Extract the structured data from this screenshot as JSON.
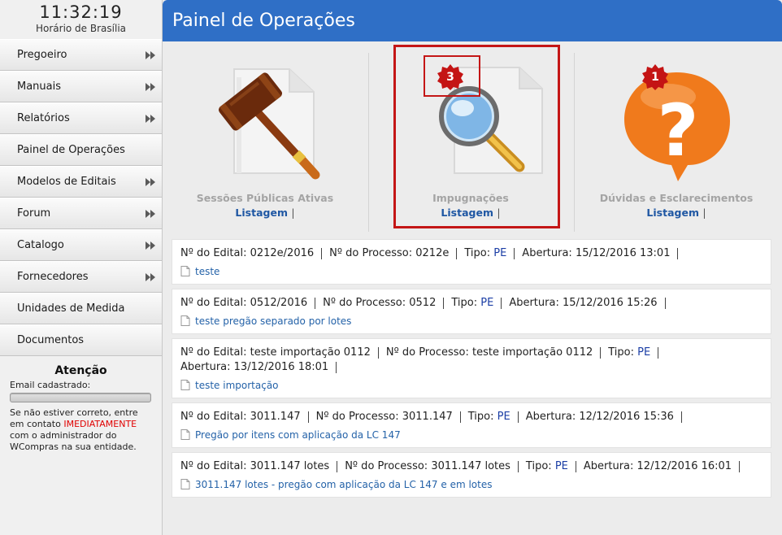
{
  "sidebar": {
    "clock": {
      "time": "11:32:19",
      "timezone": "Horário de Brasília"
    },
    "items": [
      {
        "label": "Pregoeiro",
        "has_submenu": true
      },
      {
        "label": "Manuais",
        "has_submenu": true
      },
      {
        "label": "Relatórios",
        "has_submenu": true
      },
      {
        "label": "Painel de Operações",
        "has_submenu": false
      },
      {
        "label": "Modelos de Editais",
        "has_submenu": true
      },
      {
        "label": "Forum",
        "has_submenu": true
      },
      {
        "label": "Catalogo",
        "has_submenu": true
      },
      {
        "label": "Fornecedores",
        "has_submenu": true
      },
      {
        "label": "Unidades de Medida",
        "has_submenu": false
      },
      {
        "label": "Documentos",
        "has_submenu": false
      }
    ],
    "attention": {
      "title": "Atenção",
      "email_label": "Email cadastrado:",
      "msg_part1": "Se não estiver correto, entre em contato ",
      "msg_highlight": "IMEDIATAMENTE",
      "msg_part2": " com o administrador do WCompras na sua entidade."
    }
  },
  "header": {
    "title": "Painel de Operações"
  },
  "cards": [
    {
      "title": "Sessões Públicas Ativas",
      "link": "Listagem",
      "sep": "|",
      "icon": "gavel-document-icon"
    },
    {
      "title": "Impugnações",
      "link": "Listagem",
      "sep": "|",
      "icon": "magnifier-document-icon",
      "badge": "3"
    },
    {
      "title": "Dúvidas e Esclarecimentos",
      "link": "Listagem",
      "sep": "|",
      "icon": "question-bubble-icon",
      "badge": "1"
    }
  ],
  "labels": {
    "edital": "Nº do Edital:",
    "processo": "Nº do Processo:",
    "tipo": "Tipo:",
    "abertura": "Abertura:"
  },
  "records": [
    {
      "edital": "0212e/2016",
      "processo": "0212e",
      "tipo": "PE",
      "abertura": "15/12/2016 13:01",
      "doc": "teste"
    },
    {
      "edital": "0512/2016",
      "processo": "0512",
      "tipo": "PE",
      "abertura": "15/12/2016 15:26",
      "doc": "teste pregão separado por lotes"
    },
    {
      "edital": "teste importação 0112",
      "processo": "teste importação 0112",
      "tipo": "PE",
      "abertura": "13/12/2016 18:01",
      "doc": "teste importação"
    },
    {
      "edital": "3011.147",
      "processo": "3011.147",
      "tipo": "PE",
      "abertura": "12/12/2016 15:36",
      "doc": "Pregão por itens com aplicação da LC 147"
    },
    {
      "edital": "3011.147 lotes",
      "processo": "3011.147 lotes",
      "tipo": "PE",
      "abertura": "12/12/2016 16:01",
      "doc": "3011.147 lotes - pregão com aplicação da LC 147 e em lotes"
    }
  ]
}
